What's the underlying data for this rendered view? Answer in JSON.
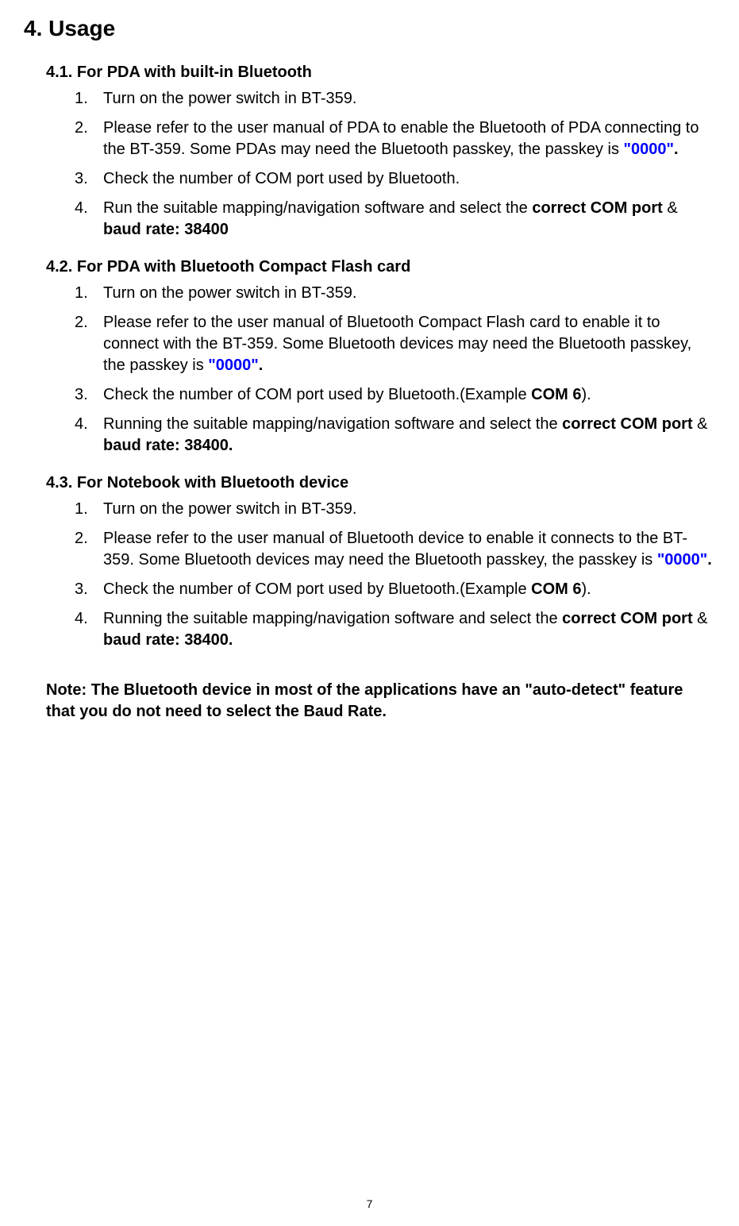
{
  "main_heading": "4.  Usage",
  "sections": [
    {
      "heading": "4.1. For PDA with built-in Bluetooth",
      "items": [
        {
          "num": "1.",
          "parts": [
            {
              "text": "Turn on the power switch in BT-359.",
              "style": ""
            }
          ]
        },
        {
          "num": "2.",
          "parts": [
            {
              "text": "Please refer to the user manual of PDA to enable the Bluetooth of PDA connecting to the BT-359. Some PDAs may need the Bluetooth passkey, the passkey is ",
              "style": ""
            },
            {
              "text": "\"0000\"",
              "style": "blue"
            },
            {
              "text": ".",
              "style": "bold"
            }
          ]
        },
        {
          "num": "3.",
          "parts": [
            {
              "text": "Check the number of COM port used by Bluetooth.",
              "style": ""
            }
          ]
        },
        {
          "num": "4.",
          "parts": [
            {
              "text": "Run the suitable mapping/navigation software and select the ",
              "style": ""
            },
            {
              "text": "correct COM port",
              "style": "bold"
            },
            {
              "text": " & ",
              "style": ""
            },
            {
              "text": "baud rate: 38400",
              "style": "bold"
            }
          ]
        }
      ]
    },
    {
      "heading": "4.2. For PDA with Bluetooth Compact Flash card",
      "items": [
        {
          "num": "1.",
          "parts": [
            {
              "text": "Turn on the power switch in BT-359.",
              "style": ""
            }
          ]
        },
        {
          "num": "2.",
          "parts": [
            {
              "text": "Please refer to the user manual of Bluetooth Compact Flash card to enable it to connect with the BT-359. Some Bluetooth devices may need the Bluetooth passkey, the passkey is ",
              "style": ""
            },
            {
              "text": "\"0000\"",
              "style": "blue"
            },
            {
              "text": ".",
              "style": "bold"
            }
          ]
        },
        {
          "num": "3.",
          "parts": [
            {
              "text": "Check the number of COM port used by Bluetooth.(Example ",
              "style": ""
            },
            {
              "text": "COM 6",
              "style": "bold"
            },
            {
              "text": ").",
              "style": ""
            }
          ]
        },
        {
          "num": "4.",
          "parts": [
            {
              "text": "Running the suitable mapping/navigation software and select the ",
              "style": ""
            },
            {
              "text": "correct COM port",
              "style": "bold"
            },
            {
              "text": " & ",
              "style": ""
            },
            {
              "text": "baud rate: 38400.",
              "style": "bold"
            }
          ]
        }
      ]
    },
    {
      "heading": "4.3. For Notebook with Bluetooth device",
      "items": [
        {
          "num": "1.",
          "parts": [
            {
              "text": "Turn on the power switch in BT-359.",
              "style": ""
            }
          ]
        },
        {
          "num": "2.",
          "parts": [
            {
              "text": "Please refer to the user manual of Bluetooth device to enable it connects to the BT-359. Some Bluetooth devices may need the Bluetooth passkey, the passkey is ",
              "style": ""
            },
            {
              "text": "\"0000\"",
              "style": "blue"
            },
            {
              "text": ".",
              "style": "bold"
            }
          ]
        },
        {
          "num": "3.",
          "parts": [
            {
              "text": "Check the number of COM port used by Bluetooth.(Example ",
              "style": ""
            },
            {
              "text": "COM 6",
              "style": "bold"
            },
            {
              "text": ").",
              "style": ""
            }
          ]
        },
        {
          "num": "4.",
          "parts": [
            {
              "text": "Running the suitable mapping/navigation software and select the ",
              "style": ""
            },
            {
              "text": "correct COM port",
              "style": "bold"
            },
            {
              "text": " & ",
              "style": ""
            },
            {
              "text": "baud rate: 38400.",
              "style": "bold"
            }
          ]
        }
      ]
    }
  ],
  "note": "Note: The Bluetooth device in most of the applications have an \"auto-detect\" feature that you do not need to select the Baud Rate.",
  "page_number": "7"
}
